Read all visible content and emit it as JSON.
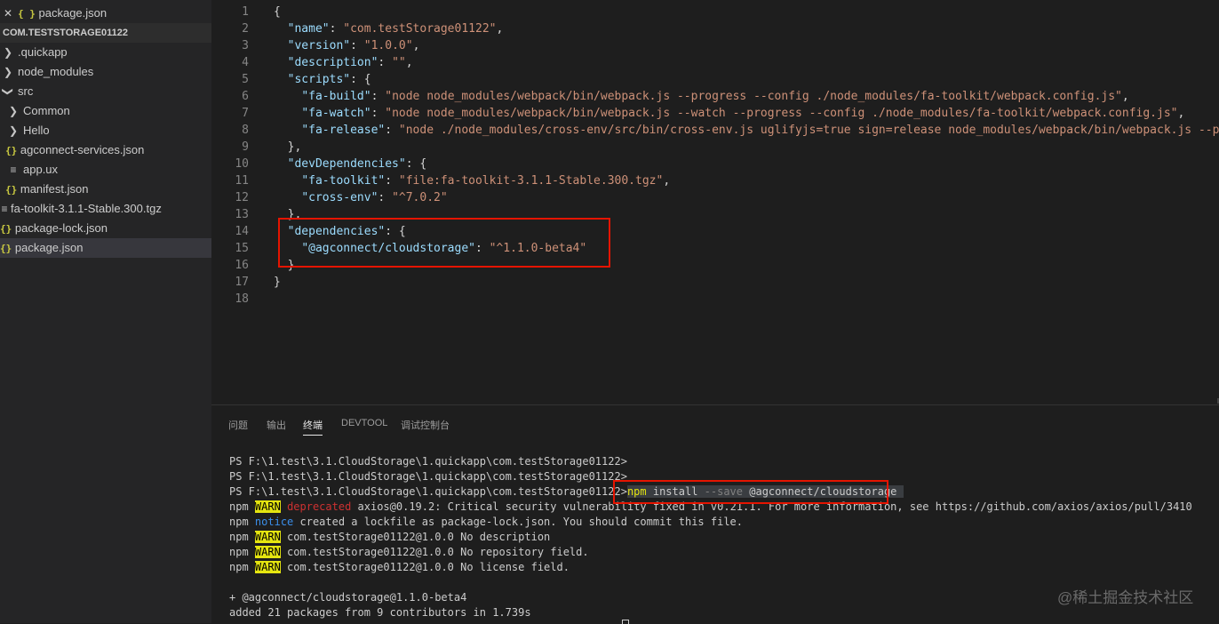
{
  "sidebar": {
    "open_editor": {
      "close": "✕",
      "label": "package.json"
    },
    "project_title": "COM.TESTSTORAGE01122",
    "tree": [
      {
        "label": ".quickapp"
      },
      {
        "label": "node_modules"
      },
      {
        "label": "src"
      },
      {
        "label": "Common"
      },
      {
        "label": "Hello"
      },
      {
        "label": "agconnect-services.json"
      },
      {
        "label": "app.ux"
      },
      {
        "label": "manifest.json"
      },
      {
        "label": "fa-toolkit-3.1.1-Stable.300.tgz"
      },
      {
        "label": "package-lock.json"
      },
      {
        "label": "package.json"
      }
    ]
  },
  "editor": {
    "line_numbers": [
      "1",
      "2",
      "3",
      "4",
      "5",
      "6",
      "7",
      "8",
      "9",
      "10",
      "11",
      "12",
      "13",
      "14",
      "15",
      "16",
      "17",
      "18"
    ],
    "lines": [
      {
        "indent": "",
        "key": "",
        "sep": "",
        "val": "",
        "tail": "{"
      },
      {
        "indent": "  ",
        "key": "\"name\"",
        "sep": ": ",
        "val": "\"com.testStorage01122\"",
        "tail": ","
      },
      {
        "indent": "  ",
        "key": "\"version\"",
        "sep": ": ",
        "val": "\"1.0.0\"",
        "tail": ","
      },
      {
        "indent": "  ",
        "key": "\"description\"",
        "sep": ": ",
        "val": "\"\"",
        "tail": ","
      },
      {
        "indent": "  ",
        "key": "\"scripts\"",
        "sep": ": ",
        "val": "",
        "tail": "{"
      },
      {
        "indent": "    ",
        "key": "\"fa-build\"",
        "sep": ": ",
        "val": "\"node node_modules/webpack/bin/webpack.js --progress --config ./node_modules/fa-toolkit/webpack.config.js\"",
        "tail": ","
      },
      {
        "indent": "    ",
        "key": "\"fa-watch\"",
        "sep": ": ",
        "val": "\"node node_modules/webpack/bin/webpack.js --watch --progress --config ./node_modules/fa-toolkit/webpack.config.js\"",
        "tail": ","
      },
      {
        "indent": "    ",
        "key": "\"fa-release\"",
        "sep": ": ",
        "val": "\"node ./node_modules/cross-env/src/bin/cross-env.js uglifyjs=true sign=release node_modules/webpack/bin/webpack.js --prog",
        "tail": ""
      },
      {
        "indent": "  ",
        "key": "",
        "sep": "",
        "val": "",
        "tail": "},"
      },
      {
        "indent": "  ",
        "key": "\"devDependencies\"",
        "sep": ": ",
        "val": "",
        "tail": "{"
      },
      {
        "indent": "    ",
        "key": "\"fa-toolkit\"",
        "sep": ": ",
        "val": "\"file:fa-toolkit-3.1.1-Stable.300.tgz\"",
        "tail": ","
      },
      {
        "indent": "    ",
        "key": "\"cross-env\"",
        "sep": ": ",
        "val": "\"^7.0.2\"",
        "tail": ""
      },
      {
        "indent": "  ",
        "key": "",
        "sep": "",
        "val": "",
        "tail": "},"
      },
      {
        "indent": "  ",
        "key": "\"dependencies\"",
        "sep": ": ",
        "val": "",
        "tail": "{"
      },
      {
        "indent": "    ",
        "key": "\"@agconnect/cloudstorage\"",
        "sep": ": ",
        "val": "\"^1.1.0-beta4\"",
        "tail": ""
      },
      {
        "indent": "  ",
        "key": "",
        "sep": "",
        "val": "",
        "tail": "}"
      },
      {
        "indent": "",
        "key": "",
        "sep": "",
        "val": "",
        "tail": "}"
      },
      {
        "indent": "",
        "key": "",
        "sep": "",
        "val": "",
        "tail": ""
      }
    ]
  },
  "panel": {
    "tabs": [
      "问题",
      "输出",
      "终端",
      "DEVTOOL",
      "调试控制台"
    ],
    "active_tab": "终端"
  },
  "terminal": {
    "prompt": "PS F:\\1.test\\3.1.CloudStorage\\1.quickapp\\com.testStorage01122>",
    "cmd": {
      "npm": "npm",
      "install": " install ",
      "flag": "--save",
      "pkg": " @agconnect/cloudstorage"
    },
    "npm": "npm",
    "warn": "WARN",
    "notice": "notice",
    "deprecated": "deprecated",
    "lines": {
      "deprecated_msg": " axios@0.19.2: Critical security vulnerability fixed in v0.21.1. For more information, see https://github.com/axios/axios/pull/3410",
      "notice_msg": " created a lockfile as package-lock.json. You should commit this file.",
      "warn1": " com.testStorage01122@1.0.0 No description",
      "warn2": " com.testStorage01122@1.0.0 No repository field.",
      "warn3": " com.testStorage01122@1.0.0 No license field.",
      "added_pkg": "+ @agconnect/cloudstorage@1.1.0-beta4",
      "added_summary": "added 21 packages from 9 contributors in 1.739s"
    }
  },
  "watermark": "@稀土掘金技术社区",
  "colors": {
    "highlight_box": "#e51400",
    "warn_bg": "#e5e510",
    "key": "#9cdcfe",
    "string": "#ce9178"
  }
}
